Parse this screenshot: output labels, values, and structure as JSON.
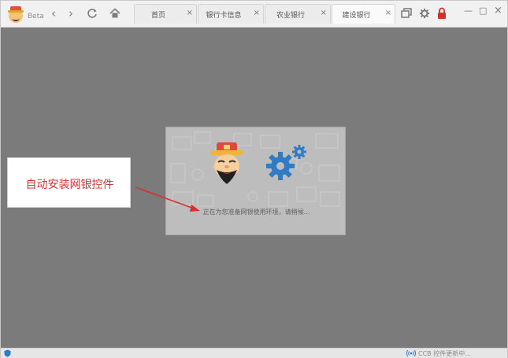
{
  "app": {
    "beta_label": "Beta"
  },
  "tabs": [
    {
      "label": "首页",
      "active": false
    },
    {
      "label": "银行卡信息",
      "active": false
    },
    {
      "label": "农业银行",
      "active": false
    },
    {
      "label": "建设银行",
      "active": true
    }
  ],
  "tab_close_glyph": "×",
  "window_controls": {
    "minimize": "—",
    "maximize": "□",
    "close": "×"
  },
  "dialog": {
    "loading_text": "正在为您准备网银使用环境，请稍候..."
  },
  "annotation": {
    "text": "自动安装网银控件",
    "color": "#e03030"
  },
  "statusbar": {
    "text": "CCB 控件更新中..."
  },
  "colors": {
    "gear": "#2f7bc6",
    "lock": "#d0312d",
    "overlay": "#7b7b7b"
  },
  "icons": [
    "app-logo-icon",
    "back-icon",
    "forward-icon",
    "refresh-icon",
    "home-icon",
    "multi-window-icon",
    "settings-icon",
    "lock-icon",
    "shield-icon",
    "signal-icon"
  ]
}
